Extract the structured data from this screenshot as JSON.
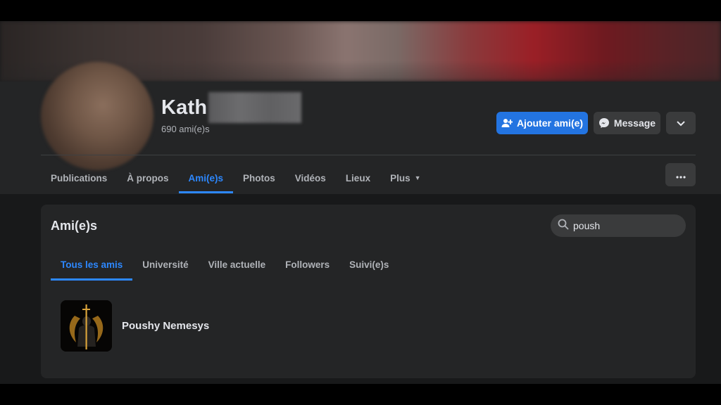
{
  "profile": {
    "name_visible": "Kath",
    "friend_count": "690 ami(e)s"
  },
  "actions": {
    "add_friend": "Ajouter ami(e)",
    "message": "Message"
  },
  "tabs": [
    {
      "label": "Publications"
    },
    {
      "label": "À propos"
    },
    {
      "label": "Ami(e)s"
    },
    {
      "label": "Photos"
    },
    {
      "label": "Vidéos"
    },
    {
      "label": "Lieux"
    },
    {
      "label": "Plus"
    }
  ],
  "friends_panel": {
    "title": "Ami(e)s",
    "search_value": "poush",
    "subtabs": [
      {
        "label": "Tous les amis"
      },
      {
        "label": "Université"
      },
      {
        "label": "Ville actuelle"
      },
      {
        "label": "Followers"
      },
      {
        "label": "Suivi(e)s"
      }
    ],
    "results": [
      {
        "name": "Poushy Nemesys"
      }
    ]
  },
  "colors": {
    "accent": "#2d88ff",
    "primary_button": "#2374e1",
    "surface": "#242526",
    "background": "#18191a"
  }
}
